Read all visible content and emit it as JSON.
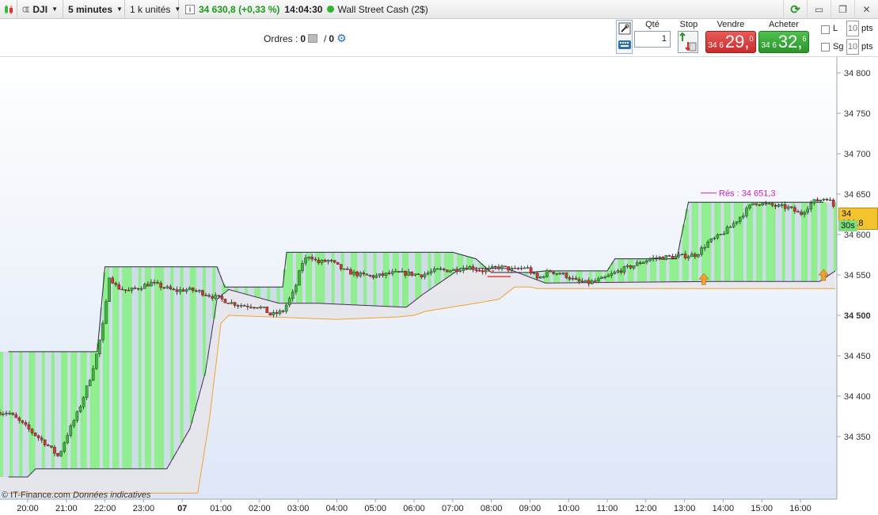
{
  "toolbar": {
    "symbol": "DJI",
    "timeframe": "5 minutes",
    "units": "1 k unités",
    "price": "34 630,8",
    "change": "(+0,33 %)",
    "time": "14:04:30",
    "instrument": "Wall Street Cash (2$)",
    "info_label": "i"
  },
  "orders": {
    "label": "Ordres :",
    "count": "0",
    "slash": "/",
    "count2": "0"
  },
  "trade_panel": {
    "qty_label": "Qté",
    "qty_value": "1",
    "stop_label": "Stop",
    "sell_label": "Vendre",
    "buy_label": "Acheter",
    "sell_prefix": "34 6",
    "sell_big": "29,",
    "sell_sup": "0",
    "buy_prefix": "34 6",
    "buy_big": "32,",
    "buy_sup": "6",
    "limit_label": "L",
    "limit_value": "10",
    "limit_unit": "pts",
    "stop_g_label": "Sg",
    "stop_g_value": "10",
    "stop_g_unit": "pts"
  },
  "colors": {
    "bull": "#3db83d",
    "bear": "#e03030",
    "band_green": "#90ee90",
    "band_gray": "#cfdde7",
    "trail": "#f5a030",
    "resistance": "#d020c0",
    "current_price_bg": "#f4c430"
  },
  "chart_data": {
    "type": "candlestick",
    "x_ticks": [
      "20:00",
      "21:00",
      "22:00",
      "23:00",
      "07",
      "01:00",
      "02:00",
      "03:00",
      "04:00",
      "05:00",
      "06:00",
      "07:00",
      "08:00",
      "09:00",
      "10:00",
      "11:00",
      "12:00",
      "13:00",
      "14:00",
      "15:00",
      "16:00"
    ],
    "y_ticks": [
      "34 800",
      "34 750",
      "34 700",
      "34 650",
      "34 600",
      "34 550",
      "34 500",
      "34 450",
      "34 400",
      "34 350"
    ],
    "y_range": [
      34280,
      34820
    ],
    "resistance_label": "Rés : 34 651,3",
    "resistance_value": 34651.3,
    "current_price": "34 630,8",
    "countdown": "30s",
    "copyright": "© IT-Finance.com",
    "disclaimer": "Données indicatives",
    "series": [
      {
        "name": "price",
        "values": [
          [
            19.5,
            34380
          ],
          [
            20.0,
            34360
          ],
          [
            20.5,
            34340
          ],
          [
            20.8,
            34325
          ],
          [
            21.0,
            34350
          ],
          [
            21.3,
            34380
          ],
          [
            21.6,
            34420
          ],
          [
            21.8,
            34455
          ],
          [
            22.0,
            34500
          ],
          [
            22.1,
            34550
          ],
          [
            22.3,
            34535
          ],
          [
            22.6,
            34530
          ],
          [
            22.9,
            34535
          ],
          [
            23.2,
            34540
          ],
          [
            23.5,
            34535
          ],
          [
            23.8,
            34530
          ],
          [
            24.1,
            34532
          ],
          [
            24.4,
            34530
          ],
          [
            24.7,
            34525
          ],
          [
            25.0,
            34520
          ],
          [
            25.3,
            34515
          ],
          [
            25.6,
            34512
          ],
          [
            25.9,
            34512
          ],
          [
            26.1,
            34508
          ],
          [
            26.3,
            34500
          ],
          [
            26.6,
            34505
          ],
          [
            26.9,
            34530
          ],
          [
            27.1,
            34565
          ],
          [
            27.3,
            34575
          ],
          [
            27.5,
            34565
          ],
          [
            27.8,
            34568
          ],
          [
            28.2,
            34555
          ],
          [
            28.6,
            34550
          ],
          [
            29.0,
            34548
          ],
          [
            29.4,
            34552
          ],
          [
            29.8,
            34552
          ],
          [
            30.2,
            34550
          ],
          [
            30.6,
            34556
          ],
          [
            31.0,
            34556
          ],
          [
            31.4,
            34560
          ],
          [
            31.8,
            34555
          ],
          [
            32.2,
            34560
          ],
          [
            32.6,
            34556
          ],
          [
            32.9,
            34560
          ],
          [
            33.2,
            34545
          ],
          [
            33.5,
            34555
          ],
          [
            33.9,
            34550
          ],
          [
            34.2,
            34542
          ],
          [
            34.5,
            34540
          ],
          [
            34.9,
            34545
          ],
          [
            35.3,
            34555
          ],
          [
            35.7,
            34562
          ],
          [
            36.1,
            34570
          ],
          [
            36.5,
            34572
          ],
          [
            36.9,
            34573
          ],
          [
            37.3,
            34575
          ],
          [
            37.6,
            34590
          ],
          [
            37.9,
            34598
          ],
          [
            38.2,
            34610
          ],
          [
            38.5,
            34625
          ],
          [
            38.8,
            34640
          ],
          [
            39.1,
            34637
          ],
          [
            39.4,
            34635
          ],
          [
            39.7,
            34633
          ],
          [
            40.0,
            34625
          ],
          [
            40.3,
            34640
          ],
          [
            40.7,
            34646
          ],
          [
            40.9,
            34632
          ]
        ]
      },
      {
        "name": "stop_band_top",
        "values": [
          [
            19.5,
            34455
          ],
          [
            21.8,
            34455
          ],
          [
            22.0,
            34560
          ],
          [
            24.9,
            34560
          ],
          [
            25.1,
            34535
          ],
          [
            26.6,
            34535
          ],
          [
            26.7,
            34578
          ],
          [
            31.0,
            34578
          ],
          [
            31.6,
            34570
          ],
          [
            32.0,
            34553
          ],
          [
            33.0,
            34553
          ],
          [
            33.4,
            34555
          ],
          [
            35.0,
            34555
          ],
          [
            35.2,
            34570
          ],
          [
            36.8,
            34570
          ],
          [
            37.1,
            34640
          ],
          [
            40.6,
            34640
          ]
        ]
      },
      {
        "name": "stop_band_bottom",
        "values": [
          [
            19.5,
            34300
          ],
          [
            20.0,
            34300
          ],
          [
            20.2,
            34310
          ],
          [
            23.6,
            34310
          ],
          [
            24.2,
            34360
          ],
          [
            24.6,
            34430
          ],
          [
            24.9,
            34520
          ],
          [
            25.2,
            34532
          ],
          [
            26.5,
            34515
          ],
          [
            27.5,
            34515
          ],
          [
            29.8,
            34510
          ],
          [
            30.2,
            34525
          ],
          [
            31.2,
            34558
          ],
          [
            32.0,
            34558
          ],
          [
            32.4,
            34558
          ],
          [
            33.4,
            34540
          ],
          [
            37.8,
            34542
          ],
          [
            38.4,
            34542
          ],
          [
            40.5,
            34542
          ],
          [
            40.9,
            34555
          ]
        ]
      },
      {
        "name": "trailing_stop",
        "values": [
          [
            19.5,
            34280
          ],
          [
            24.4,
            34280
          ],
          [
            24.7,
            34370
          ],
          [
            25.0,
            34490
          ],
          [
            25.2,
            34500
          ],
          [
            28.0,
            34495
          ],
          [
            29.6,
            34498
          ],
          [
            30.0,
            34500
          ],
          [
            30.3,
            34505
          ],
          [
            31.6,
            34515
          ],
          [
            32.2,
            34520
          ],
          [
            32.6,
            34535
          ],
          [
            33.0,
            34535
          ],
          [
            33.2,
            34533
          ],
          [
            40.9,
            34533
          ]
        ]
      }
    ]
  }
}
